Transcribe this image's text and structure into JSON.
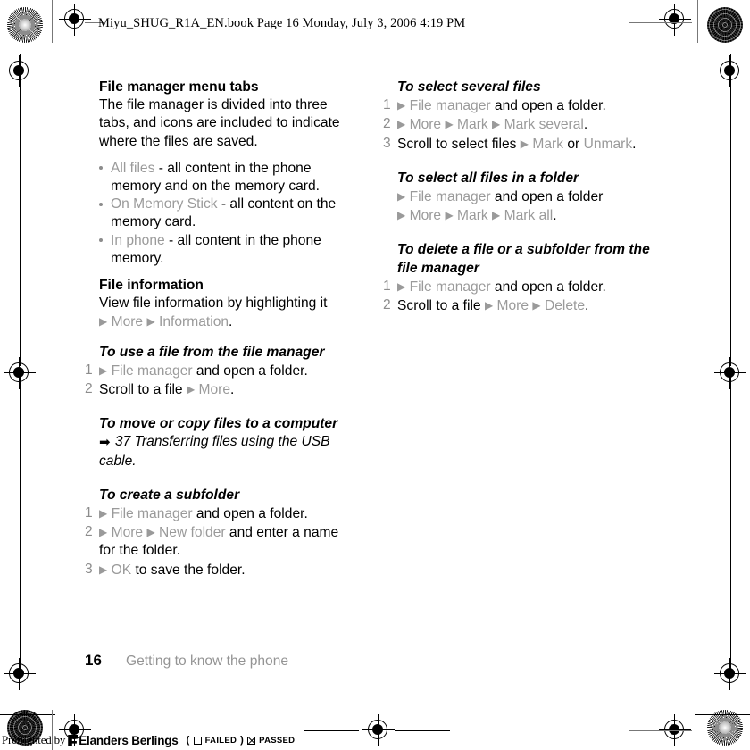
{
  "header": {
    "slug": "Miyu_SHUG_R1A_EN.book  Page 16  Monday, July 3, 2006  4:19 PM"
  },
  "left_column": {
    "section_title": "File manager menu tabs",
    "intro": "The file manager is divided into three tabs, and icons are included to indicate where the files are saved.",
    "bullets": [
      {
        "menu": "All files",
        "text": " - all content in the phone memory and on the memory card."
      },
      {
        "menu": "On Memory Stick",
        "text": " - all content on the memory card."
      },
      {
        "menu": "In phone",
        "text": " - all content in the phone memory."
      }
    ],
    "file_info_title": "File information",
    "file_info_line1": "View file information by highlighting it",
    "file_info_menu1": "More",
    "file_info_menu2": "Information",
    "proc_use_file": {
      "title": "To use a file from the file manager",
      "step1_menu": "File manager",
      "step1_text": " and open a folder.",
      "step2_text": "Scroll to a file ",
      "step2_menu": "More"
    },
    "proc_move_copy": {
      "title": "To move or copy files to a computer",
      "xref": "37 Transferring files using the USB cable."
    },
    "proc_subfolder": {
      "title": "To create a subfolder",
      "step1_menu": "File manager",
      "step1_text": " and open a folder.",
      "step2_menu_a": "More",
      "step2_menu_b": "New folder",
      "step2_text": " and enter a name for the folder.",
      "step3_menu": "OK",
      "step3_text": " to save the folder."
    }
  },
  "right_column": {
    "proc_select_several": {
      "title": "To select several files",
      "step1_menu": "File manager",
      "step1_text": " and open a folder.",
      "step2_menu_a": "More",
      "step2_menu_b": "Mark",
      "step2_menu_c": "Mark several",
      "step3_text_a": "Scroll to select files ",
      "step3_menu_a": "Mark",
      "step3_text_b": " or ",
      "step3_menu_b": "Unmark"
    },
    "proc_select_all": {
      "title": "To select all files in a folder",
      "step1_menu": "File manager",
      "step1_text": " and open a folder",
      "step2_menu_a": "More",
      "step2_menu_b": "Mark",
      "step2_menu_c": "Mark all"
    },
    "proc_delete": {
      "title": "To delete a file or a subfolder from the file manager",
      "step1_menu": "File manager",
      "step1_text": " and open a folder.",
      "step2_text": "Scroll to a file ",
      "step2_menu_a": "More",
      "step2_menu_b": "Delete"
    }
  },
  "footer": {
    "page_number": "16",
    "chapter": "Getting to know the phone"
  },
  "preflight": {
    "by_label": "Preflighted by",
    "brand": "Elanders Berlings",
    "paren_open": "(",
    "failed_label": "FAILED",
    "paren_close": ")",
    "passed_label": "PASSED"
  },
  "glyphs": {
    "triangle": "▶",
    "period": ".",
    "arrow": "➡"
  },
  "colors": {
    "menu_gray": "#9a9a9a",
    "chapter_gray": "#949494",
    "text_black": "#000000"
  }
}
